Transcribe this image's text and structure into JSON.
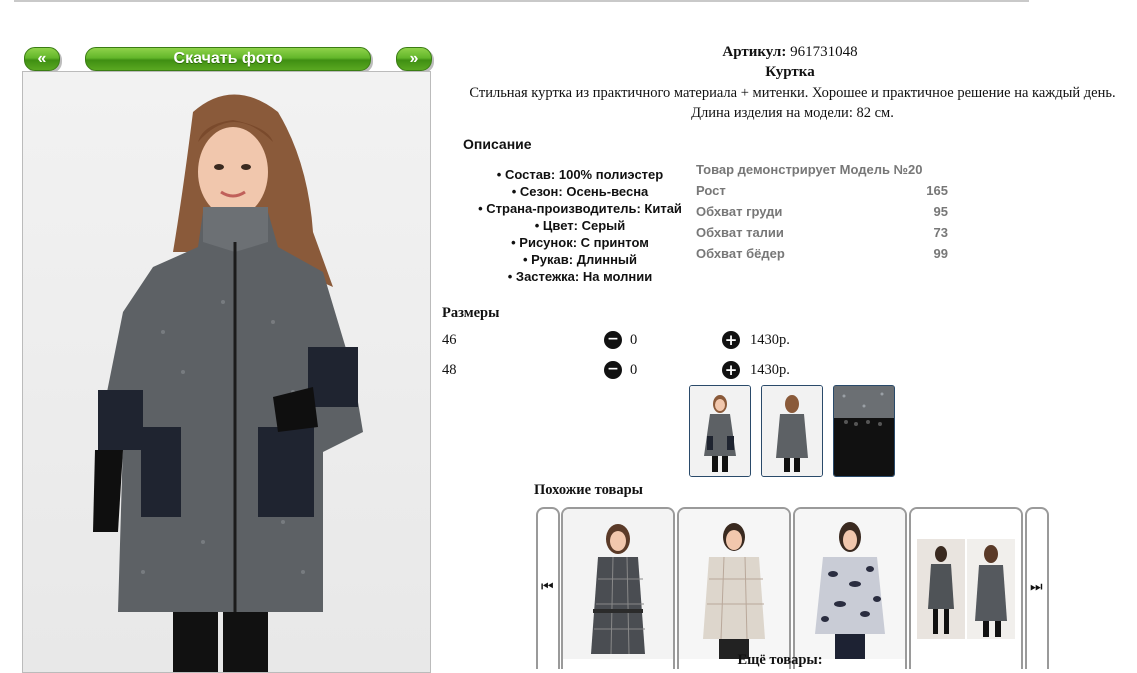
{
  "nav": {
    "prev_label": "«",
    "download_label": "Скачать фото",
    "next_label": "»"
  },
  "product": {
    "article_label": "Артикул:",
    "article_value": "961731048",
    "title": "Куртка",
    "description": "Стильная куртка из практичного материала + митенки. Хорошее и практичное решение на каждый день. Длина изделия на модели: 82 см."
  },
  "description_block": {
    "heading": "Описание",
    "props": [
      "Состав: 100% полиэстер",
      "Сезон: Осень-весна",
      "Страна-производитель: Китай",
      "Цвет: Серый",
      "Рисунок: С принтом",
      "Рукав: Длинный",
      "Застежка: На молнии"
    ]
  },
  "model": {
    "heading": "Товар демонстрирует Модель №20",
    "rows": [
      {
        "label": "Рост",
        "value": "165"
      },
      {
        "label": "Обхват груди",
        "value": "95"
      },
      {
        "label": "Обхват талии",
        "value": "73"
      },
      {
        "label": "Обхват бёдер",
        "value": "99"
      }
    ]
  },
  "sizes": {
    "heading": "Размеры",
    "rows": [
      {
        "size": "46",
        "qty": "0",
        "price": "1430р."
      },
      {
        "size": "48",
        "qty": "0",
        "price": "1430р."
      }
    ]
  },
  "similar": {
    "heading": "Похожие товары",
    "prev_icon": "skip-back-icon",
    "next_icon": "skip-forward-icon"
  },
  "more_label": "Ещё товары:",
  "colors": {
    "button_green": "#5aa821",
    "coat_gray": "#5d6165",
    "thumb_border": "#2a4a6a"
  }
}
